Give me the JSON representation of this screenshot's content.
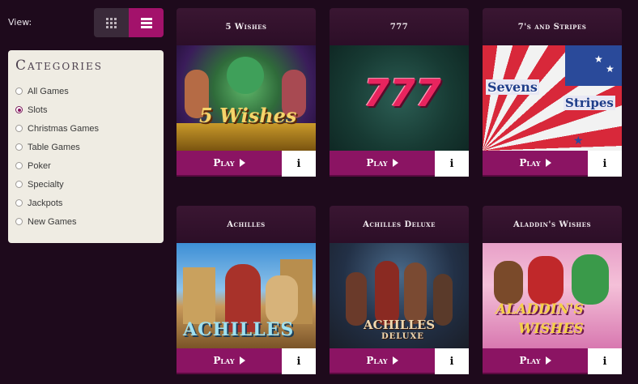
{
  "view": {
    "label": "View:",
    "grid_icon": "grid-icon",
    "list_icon": "list-icon"
  },
  "categories": {
    "title": "Categories",
    "selected": "Slots",
    "items": [
      {
        "label": "All Games"
      },
      {
        "label": "Slots"
      },
      {
        "label": "Christmas Games"
      },
      {
        "label": "Table Games"
      },
      {
        "label": "Poker"
      },
      {
        "label": "Specialty"
      },
      {
        "label": "Jackpots"
      },
      {
        "label": "New Games"
      }
    ]
  },
  "games": [
    {
      "title": "5 Wishes",
      "art_text": "5 Wishes",
      "play": "Play",
      "info": "i"
    },
    {
      "title": "777",
      "art_text": "777",
      "play": "Play",
      "info": "i"
    },
    {
      "title": "7's and Stripes",
      "art_text_1": "Sevens",
      "art_text_2": "Stripes",
      "play": "Play",
      "info": "i"
    },
    {
      "title": "Achilles",
      "art_text": "ACHILLES",
      "play": "Play",
      "info": "i"
    },
    {
      "title": "Achilles Deluxe",
      "art_text_1": "ACHILLES",
      "art_text_2": "DELUXE",
      "play": "Play",
      "info": "i"
    },
    {
      "title": "Aladdin's Wishes",
      "art_text_1": "ALADDIN'S",
      "art_text_2": "WISHES",
      "play": "Play",
      "info": "i"
    }
  ],
  "colors": {
    "background": "#1e0a1c",
    "accent": "#8b1463",
    "panel": "#efece3"
  }
}
